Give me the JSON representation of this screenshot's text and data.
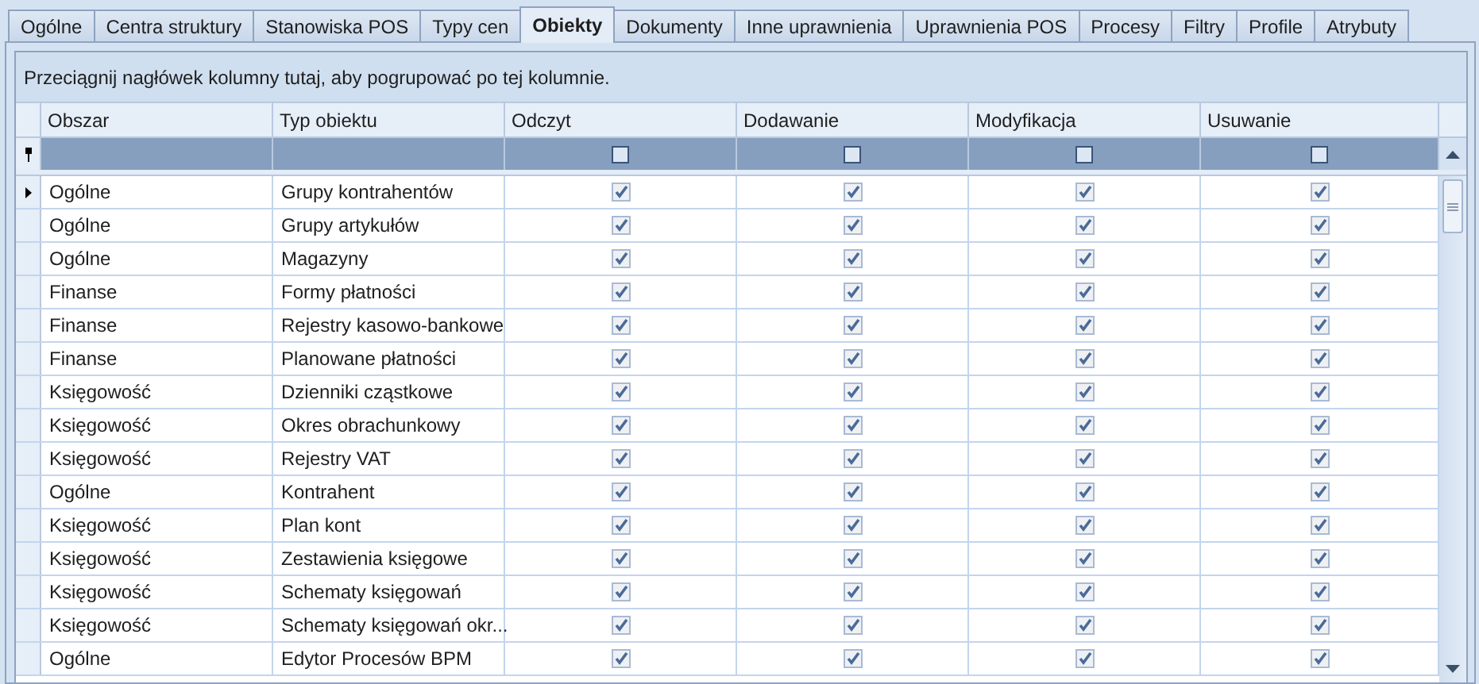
{
  "tabs": [
    {
      "label": "Ogólne",
      "selected": false
    },
    {
      "label": "Centra struktury",
      "selected": false
    },
    {
      "label": "Stanowiska POS",
      "selected": false
    },
    {
      "label": "Typy cen",
      "selected": false
    },
    {
      "label": "Obiekty",
      "selected": true
    },
    {
      "label": "Dokumenty",
      "selected": false
    },
    {
      "label": "Inne uprawnienia",
      "selected": false
    },
    {
      "label": "Uprawnienia POS",
      "selected": false
    },
    {
      "label": "Procesy",
      "selected": false
    },
    {
      "label": "Filtry",
      "selected": false
    },
    {
      "label": "Profile",
      "selected": false
    },
    {
      "label": "Atrybuty",
      "selected": false
    }
  ],
  "group_panel": {
    "text": "Przeciągnij nagłówek kolumny tutaj, aby pogrupować po tej kolumnie."
  },
  "table": {
    "columns": [
      {
        "label": "Obszar",
        "kind": "text"
      },
      {
        "label": "Typ obiektu",
        "kind": "text"
      },
      {
        "label": "Odczyt",
        "kind": "check"
      },
      {
        "label": "Dodawanie",
        "kind": "check"
      },
      {
        "label": "Modyfikacja",
        "kind": "check"
      },
      {
        "label": "Usuwanie",
        "kind": "check"
      }
    ],
    "filter_row": [
      {
        "checked": false
      },
      {
        "checked": false
      },
      {
        "checked": false
      },
      {
        "checked": false
      }
    ],
    "rows": [
      {
        "selected": true,
        "area": "Ogólne",
        "type": "Grupy kontrahentów",
        "perms": [
          true,
          true,
          true,
          true
        ]
      },
      {
        "selected": false,
        "area": "Ogólne",
        "type": "Grupy artykułów",
        "perms": [
          true,
          true,
          true,
          true
        ]
      },
      {
        "selected": false,
        "area": "Ogólne",
        "type": "Magazyny",
        "perms": [
          true,
          true,
          true,
          true
        ]
      },
      {
        "selected": false,
        "area": "Finanse",
        "type": "Formy płatności",
        "perms": [
          true,
          true,
          true,
          true
        ]
      },
      {
        "selected": false,
        "area": "Finanse",
        "type": "Rejestry kasowo-bankowe",
        "perms": [
          true,
          true,
          true,
          true
        ]
      },
      {
        "selected": false,
        "area": "Finanse",
        "type": "Planowane płatności",
        "perms": [
          true,
          true,
          true,
          true
        ]
      },
      {
        "selected": false,
        "area": "Księgowość",
        "type": "Dzienniki cząstkowe",
        "perms": [
          true,
          true,
          true,
          true
        ]
      },
      {
        "selected": false,
        "area": "Księgowość",
        "type": "Okres obrachunkowy",
        "perms": [
          true,
          true,
          true,
          true
        ]
      },
      {
        "selected": false,
        "area": "Księgowość",
        "type": "Rejestry VAT",
        "perms": [
          true,
          true,
          true,
          true
        ]
      },
      {
        "selected": false,
        "area": "Ogólne",
        "type": "Kontrahent",
        "perms": [
          true,
          true,
          true,
          true
        ]
      },
      {
        "selected": false,
        "area": "Księgowość",
        "type": "Plan kont",
        "perms": [
          true,
          true,
          true,
          true
        ]
      },
      {
        "selected": false,
        "area": "Księgowość",
        "type": "Zestawienia księgowe",
        "perms": [
          true,
          true,
          true,
          true
        ]
      },
      {
        "selected": false,
        "area": "Księgowość",
        "type": "Schematy księgowań",
        "perms": [
          true,
          true,
          true,
          true
        ]
      },
      {
        "selected": false,
        "area": "Księgowość",
        "type": "Schematy księgowań okr...",
        "perms": [
          true,
          true,
          true,
          true
        ]
      },
      {
        "selected": false,
        "area": "Ogólne",
        "type": "Edytor Procesów BPM",
        "perms": [
          true,
          true,
          true,
          true
        ]
      }
    ]
  }
}
